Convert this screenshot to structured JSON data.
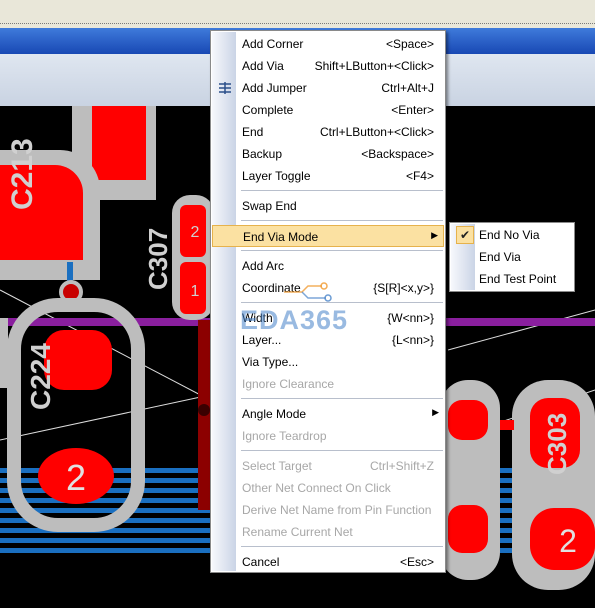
{
  "pcb": {
    "labels": [
      {
        "text": "C213",
        "rot": 90
      },
      {
        "text": "C307",
        "rot": -90
      },
      {
        "text": "C224",
        "rot": 90
      },
      {
        "text": "C303",
        "rot": 90
      }
    ],
    "pad_numbers": [
      "2",
      "1",
      "2",
      "2"
    ],
    "colors": {
      "pad": "#ff0000",
      "outline": "#bdbdbd",
      "trace_blue": "#1a6fc0",
      "trace_purple": "#8a1f9e",
      "via": "#c80000"
    }
  },
  "context_menu": {
    "items": [
      {
        "label": "Add Corner",
        "shortcut": "<Space>",
        "disabled": false
      },
      {
        "label": "Add Via",
        "shortcut": "Shift+LButton+<Click>",
        "disabled": false
      },
      {
        "label": "Add Jumper",
        "shortcut": "Ctrl+Alt+J",
        "disabled": false,
        "icon": "jumper-icon"
      },
      {
        "label": "Complete",
        "shortcut": "<Enter>",
        "disabled": false
      },
      {
        "label": "End",
        "shortcut": "Ctrl+LButton+<Click>",
        "disabled": false
      },
      {
        "label": "Backup",
        "shortcut": "<Backspace>",
        "disabled": false
      },
      {
        "label": "Layer Toggle",
        "shortcut": "<F4>",
        "disabled": false
      },
      {
        "label": "Swap End",
        "shortcut": "",
        "disabled": false
      },
      {
        "label": "End Via Mode",
        "shortcut": "",
        "disabled": false,
        "submenu": true,
        "highlighted": true
      },
      {
        "label": "Add Arc",
        "shortcut": "",
        "disabled": false
      },
      {
        "label": "Coordinate",
        "shortcut": "{S[R]<x,y>}",
        "disabled": false
      },
      {
        "label": "Width",
        "shortcut": "{W<nn>}",
        "disabled": false
      },
      {
        "label": "Layer...",
        "shortcut": "{L<nn>}",
        "disabled": false
      },
      {
        "label": "Via Type...",
        "shortcut": "",
        "disabled": false
      },
      {
        "label": "Ignore Clearance",
        "shortcut": "",
        "disabled": true
      },
      {
        "label": "Angle Mode",
        "shortcut": "",
        "disabled": false,
        "submenu": true
      },
      {
        "label": "Ignore Teardrop",
        "shortcut": "",
        "disabled": true
      },
      {
        "label": "Select Target",
        "shortcut": "Ctrl+Shift+Z",
        "disabled": true
      },
      {
        "label": "Other Net Connect On Click",
        "shortcut": "",
        "disabled": true
      },
      {
        "label": "Derive Net Name from Pin Function",
        "shortcut": "",
        "disabled": true
      },
      {
        "label": "Rename Current Net",
        "shortcut": "",
        "disabled": true
      },
      {
        "label": "Cancel",
        "shortcut": "<Esc>",
        "disabled": false
      }
    ],
    "submenu_arrow": "▶"
  },
  "submenu": {
    "items": [
      {
        "label": "End No Via",
        "checked": true
      },
      {
        "label": "End Via",
        "checked": false
      },
      {
        "label": "End Test Point",
        "checked": false
      }
    ],
    "check_glyph": "✔"
  },
  "watermark": {
    "text": "EDA365"
  }
}
